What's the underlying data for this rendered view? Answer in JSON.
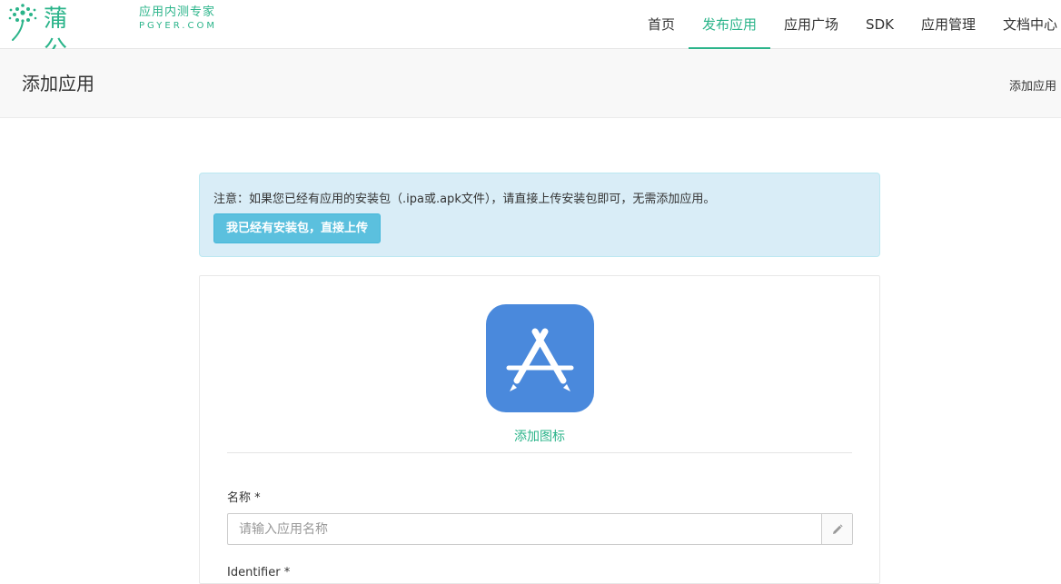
{
  "brand": {
    "name": "蒲公英",
    "tagline_cn": "应用内测专家",
    "tagline_en": "PGYER.COM",
    "color": "#2bb48a"
  },
  "nav": {
    "items": [
      {
        "label": "首页",
        "active": false
      },
      {
        "label": "发布应用",
        "active": true
      },
      {
        "label": "应用广场",
        "active": false
      },
      {
        "label": "SDK",
        "active": false
      },
      {
        "label": "应用管理",
        "active": false
      },
      {
        "label": "文档中心",
        "active": false
      }
    ]
  },
  "page": {
    "title": "添加应用",
    "breadcrumb": "添加应用"
  },
  "notice": {
    "text": "注意：如果您已经有应用的安装包（.ipa或.apk文件），请直接上传安装包即可，无需添加应用。",
    "button_label": "我已经有安装包，直接上传"
  },
  "form": {
    "icon_name": "app-store-icon",
    "icon_color": "#4a89dc",
    "add_icon_label": "添加图标",
    "name_label": "名称 *",
    "name_placeholder": "请输入应用名称",
    "name_value": "",
    "identifier_label": "Identifier *"
  }
}
